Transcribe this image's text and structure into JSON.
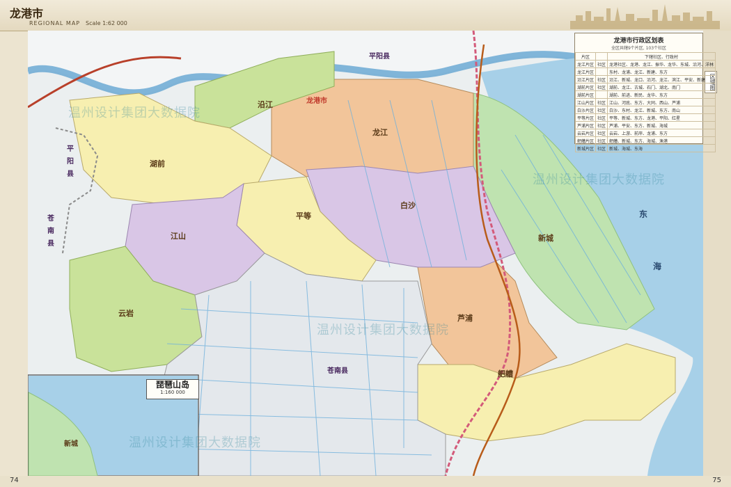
{
  "header": {
    "title": "龙港市",
    "subtitle": "REGIONAL MAP",
    "scale": "Scale 1:62 000"
  },
  "side_tab": "区域图",
  "legend": {
    "title": "龙港市行政区划表",
    "subtitle": "全区共辖9个片区, 103个社区",
    "headers": [
      "片区",
      "",
      "下辖社区、行政村"
    ],
    "rows": [
      {
        "name": "龙江片区",
        "type": "社区",
        "items": "龙港社区、龙港、龙江、振华、龙华、东城、沿河、洋林"
      },
      {
        "name": "龙江片区",
        "type": "",
        "items": "东村、龙浦、龙江、新建、东方"
      },
      {
        "name": "沿江片区",
        "type": "社区",
        "items": "沿江、新城、龙口、沿河、龙江、滨江、平安、新建"
      },
      {
        "name": "湖前片区",
        "type": "社区",
        "items": "湖前、龙江、古城、石门、湖北、南门"
      },
      {
        "name": "湖前片区",
        "type": "",
        "items": "湖前、前进、新民、龙华、东方"
      },
      {
        "name": "江山片区",
        "type": "社区",
        "items": "江山、河底、东方、大同、西山、芦浦"
      },
      {
        "name": "白沙片区",
        "type": "社区",
        "items": "白沙、东村、龙江、新城、东方、南山"
      },
      {
        "name": "平等片区",
        "type": "社区",
        "items": "平等、新城、东方、龙港、平阳、红星"
      },
      {
        "name": "芦浦片区",
        "type": "社区",
        "items": "芦浦、平安、东方、新城、海城"
      },
      {
        "name": "云岩片区",
        "type": "社区",
        "items": "云岩、上游、前岸、龙浦、东方"
      },
      {
        "name": "舥艚片区",
        "type": "社区",
        "items": "舥艚、新城、东方、海城、渔港"
      },
      {
        "name": "新城片区",
        "type": "社区",
        "items": "新城、海城、东海"
      }
    ]
  },
  "inset": {
    "title": "琵琶山岛",
    "scale": "1:160 000"
  },
  "watermark": "温州设计集团大数据院",
  "page_numbers": {
    "left": "74",
    "right": "75"
  },
  "map_labels": {
    "districts": [
      "沿江",
      "龙江",
      "湖前",
      "平等",
      "白沙",
      "江山",
      "云岩",
      "芦浦",
      "舥艚",
      "新城",
      "龙港市"
    ],
    "counties": [
      "平阳县",
      "平阳县",
      "苍南县",
      "苍南县",
      "苍南县"
    ],
    "sea": [
      "东",
      "海"
    ],
    "inset_district": "新城"
  },
  "colors": {
    "yellow": "#f7efb0",
    "green": "#c9e29a",
    "purple": "#d9c6e6",
    "orange": "#f2c59a",
    "lightgreen": "#bfe3b0",
    "water": "#a7d0e8",
    "road": "#c0392b",
    "boundary": "#9a9a9a"
  }
}
